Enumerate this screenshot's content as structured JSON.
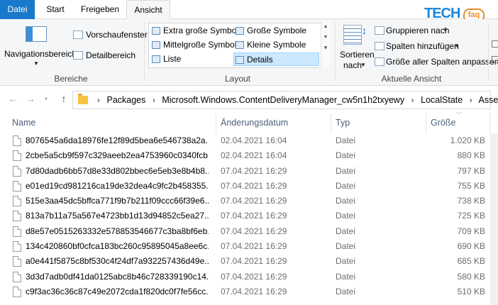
{
  "tabs": {
    "file": "Datei",
    "start": "Start",
    "share": "Freigeben",
    "view": "Ansicht"
  },
  "logo": {
    "main": "TECH",
    "badge": "faq"
  },
  "ribbon": {
    "panes": {
      "nav_pane": "Navigationsbereich",
      "preview_pane": "Vorschaufenster",
      "details_pane": "Detailbereich",
      "group_label": "Bereiche"
    },
    "layout": {
      "extra_large": "Extra große Symbole",
      "large": "Große Symbole",
      "medium": "Mittelgroße Symbole",
      "small": "Kleine Symbole",
      "list": "Liste",
      "details": "Details",
      "group_label": "Layout"
    },
    "current_view": {
      "sort_line1": "Sortieren",
      "sort_line2": "nach",
      "group_by": "Gruppieren nach",
      "add_columns": "Spalten hinzufügen",
      "fit_columns": "Größe aller Spalten anpassen",
      "group_label": "Aktuelle Ansicht"
    }
  },
  "address": {
    "crumbs": [
      "Packages",
      "Microsoft.Windows.ContentDeliveryManager_cw5n1h2txyewy",
      "LocalState",
      "Assets"
    ]
  },
  "columns": {
    "name": "Name",
    "date": "Änderungsdatum",
    "type": "Typ",
    "size": "Größe"
  },
  "files": [
    {
      "name": "8076545a6da18976fe12f89d5bea6e546738a2a...",
      "date": "02.04.2021 16:04",
      "type": "Datei",
      "size": "1.020 KB"
    },
    {
      "name": "2cbe5a5cb9f597c329aeeb2ea4753960c0340fcb...",
      "date": "02.04.2021 16:04",
      "type": "Datei",
      "size": "880 KB"
    },
    {
      "name": "7d80dadb6bb57d8e33d802bbec6e5eb3e8b4b8...",
      "date": "07.04.2021 16:29",
      "type": "Datei",
      "size": "797 KB"
    },
    {
      "name": "e01ed19cd981216ca19de32dea4c9fc2b458355...",
      "date": "07.04.2021 16:29",
      "type": "Datei",
      "size": "755 KB"
    },
    {
      "name": "515e3aa45dc5bffca771f9b7b211f09ccc66f39e6...",
      "date": "07.04.2021 16:29",
      "type": "Datei",
      "size": "738 KB"
    },
    {
      "name": "813a7b11a75a567e4723bb1d13d94852c5ea27...",
      "date": "07.04.2021 16:29",
      "type": "Datei",
      "size": "725 KB"
    },
    {
      "name": "d8e57e0515263332e578853546677c3ba8bf6eb...",
      "date": "07.04.2021 16:29",
      "type": "Datei",
      "size": "709 KB"
    },
    {
      "name": "134c420860bf0cfca183bc260c95895045a8ee6c...",
      "date": "07.04.2021 16:29",
      "type": "Datei",
      "size": "690 KB"
    },
    {
      "name": "a0e441f5875c8bf530c4f24df7a932257436d49e...",
      "date": "07.04.2021 16:29",
      "type": "Datei",
      "size": "685 KB"
    },
    {
      "name": "3d3d7adb0df41da0125abc8b46c728339190c14...",
      "date": "07.04.2021 16:29",
      "type": "Datei",
      "size": "580 KB"
    },
    {
      "name": "c9f3ac36c36c87c49e2072cda1f820dc0f7fe56cc...",
      "date": "07.04.2021 16:29",
      "type": "Datei",
      "size": "510 KB"
    }
  ]
}
